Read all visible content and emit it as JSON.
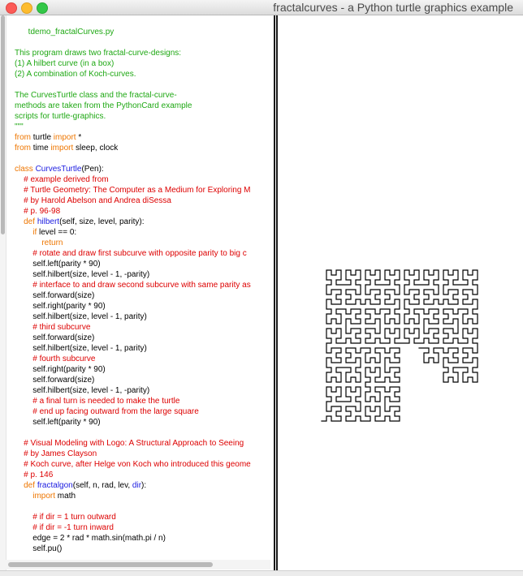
{
  "window": {
    "title": "fractalcurves - a Python turtle graphics example",
    "close_label": "close",
    "minimize_label": "minimize",
    "zoom_label": "zoom"
  },
  "code_lines": [
    [
      {
        "t": "      tdemo_fractalCurves.py",
        "c": "doc"
      }
    ],
    [
      {
        "t": "",
        "c": "tx"
      }
    ],
    [
      {
        "t": "This program draws two fractal-curve-designs:",
        "c": "doc"
      }
    ],
    [
      {
        "t": "(1) A hilbert curve (in a box)",
        "c": "doc"
      }
    ],
    [
      {
        "t": "(2) A combination of Koch-curves.",
        "c": "doc"
      }
    ],
    [
      {
        "t": "",
        "c": "tx"
      }
    ],
    [
      {
        "t": "The CurvesTurtle class and the fractal-curve-",
        "c": "doc"
      }
    ],
    [
      {
        "t": "methods are taken from the PythonCard example",
        "c": "doc"
      }
    ],
    [
      {
        "t": "scripts for turtle-graphics.",
        "c": "doc"
      }
    ],
    [
      {
        "t": "\"\"\"",
        "c": "doc"
      }
    ],
    [
      {
        "t": "from",
        "c": "kw"
      },
      {
        "t": " turtle ",
        "c": "tx"
      },
      {
        "t": "import",
        "c": "kw"
      },
      {
        "t": " *",
        "c": "tx"
      }
    ],
    [
      {
        "t": "from",
        "c": "kw"
      },
      {
        "t": " time ",
        "c": "tx"
      },
      {
        "t": "import",
        "c": "kw"
      },
      {
        "t": " sleep, clock",
        "c": "tx"
      }
    ],
    [
      {
        "t": "",
        "c": "tx"
      }
    ],
    [
      {
        "t": "class",
        "c": "kw"
      },
      {
        "t": " ",
        "c": "tx"
      },
      {
        "t": "CurvesTurtle",
        "c": "fn"
      },
      {
        "t": "(Pen):",
        "c": "tx"
      }
    ],
    [
      {
        "t": "    # example derived from",
        "c": "cm"
      }
    ],
    [
      {
        "t": "    # Turtle Geometry: The Computer as a Medium for Exploring M",
        "c": "cm"
      }
    ],
    [
      {
        "t": "    # by Harold Abelson and Andrea diSessa",
        "c": "cm"
      }
    ],
    [
      {
        "t": "    # p. 96-98",
        "c": "cm"
      }
    ],
    [
      {
        "t": "    ",
        "c": "tx"
      },
      {
        "t": "def",
        "c": "kw"
      },
      {
        "t": " ",
        "c": "tx"
      },
      {
        "t": "hilbert",
        "c": "fn"
      },
      {
        "t": "(self, size, level, parity):",
        "c": "tx"
      }
    ],
    [
      {
        "t": "        ",
        "c": "tx"
      },
      {
        "t": "if",
        "c": "kw"
      },
      {
        "t": " level == 0:",
        "c": "tx"
      }
    ],
    [
      {
        "t": "            ",
        "c": "tx"
      },
      {
        "t": "return",
        "c": "kw"
      }
    ],
    [
      {
        "t": "        # rotate and draw first subcurve with opposite parity to big c",
        "c": "cm"
      }
    ],
    [
      {
        "t": "        self.left(parity * 90)",
        "c": "tx"
      }
    ],
    [
      {
        "t": "        self.hilbert(size, level - 1, -parity)",
        "c": "tx"
      }
    ],
    [
      {
        "t": "        # interface to and draw second subcurve with same parity as",
        "c": "cm"
      }
    ],
    [
      {
        "t": "        self.forward(size)",
        "c": "tx"
      }
    ],
    [
      {
        "t": "        self.right(parity * 90)",
        "c": "tx"
      }
    ],
    [
      {
        "t": "        self.hilbert(size, level - 1, parity)",
        "c": "tx"
      }
    ],
    [
      {
        "t": "        # third subcurve",
        "c": "cm"
      }
    ],
    [
      {
        "t": "        self.forward(size)",
        "c": "tx"
      }
    ],
    [
      {
        "t": "        self.hilbert(size, level - 1, parity)",
        "c": "tx"
      }
    ],
    [
      {
        "t": "        # fourth subcurve",
        "c": "cm"
      }
    ],
    [
      {
        "t": "        self.right(parity * 90)",
        "c": "tx"
      }
    ],
    [
      {
        "t": "        self.forward(size)",
        "c": "tx"
      }
    ],
    [
      {
        "t": "        self.hilbert(size, level - 1, -parity)",
        "c": "tx"
      }
    ],
    [
      {
        "t": "        # a final turn is needed to make the turtle",
        "c": "cm"
      }
    ],
    [
      {
        "t": "        # end up facing outward from the large square",
        "c": "cm"
      }
    ],
    [
      {
        "t": "        self.left(parity * 90)",
        "c": "tx"
      }
    ],
    [
      {
        "t": "",
        "c": "tx"
      }
    ],
    [
      {
        "t": "    # Visual Modeling with Logo: A Structural Approach to Seeing",
        "c": "cm"
      }
    ],
    [
      {
        "t": "    # by James Clayson",
        "c": "cm"
      }
    ],
    [
      {
        "t": "    # Koch curve, after Helge von Koch who introduced this geome",
        "c": "cm"
      }
    ],
    [
      {
        "t": "    # p. 146",
        "c": "cm"
      }
    ],
    [
      {
        "t": "    ",
        "c": "tx"
      },
      {
        "t": "def",
        "c": "kw"
      },
      {
        "t": " ",
        "c": "tx"
      },
      {
        "t": "fractalgon",
        "c": "fn"
      },
      {
        "t": "(self, n, rad, lev, ",
        "c": "tx"
      },
      {
        "t": "dir",
        "c": "fn"
      },
      {
        "t": "):",
        "c": "tx"
      }
    ],
    [
      {
        "t": "        ",
        "c": "tx"
      },
      {
        "t": "import",
        "c": "kw"
      },
      {
        "t": " math",
        "c": "tx"
      }
    ],
    [
      {
        "t": "",
        "c": "tx"
      }
    ],
    [
      {
        "t": "        # if dir = 1 turn outward",
        "c": "cm"
      }
    ],
    [
      {
        "t": "        # if dir = -1 turn inward",
        "c": "cm"
      }
    ],
    [
      {
        "t": "        edge = 2 * rad * math.sin(math.pi / n)",
        "c": "tx"
      }
    ],
    [
      {
        "t": "        self.pu()",
        "c": "tx"
      }
    ]
  ],
  "drawing": {
    "curve": "hilbert",
    "level": 5,
    "drawn_fraction": 0.83,
    "stroke_color": "#000000"
  },
  "colors": {
    "docstring": "#1fa814",
    "keyword": "#ee7600",
    "comment": "#dd0000",
    "definition": "#1a1ae0",
    "text": "#000000"
  }
}
